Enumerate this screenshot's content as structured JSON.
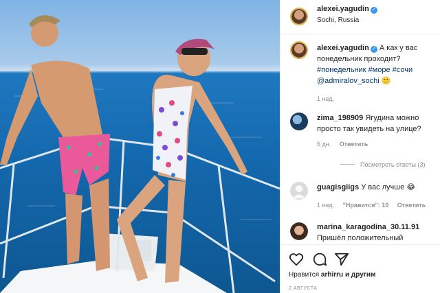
{
  "post": {
    "photo_alt": "",
    "author": "alexei.yagudin",
    "location": "Sochi, Russia"
  },
  "caption": {
    "author": "alexei.yagudin",
    "text": "А как у вас понедельник проходит?",
    "hashtags": [
      "#понедельник",
      "#море",
      "#сочи"
    ],
    "mention": "@admiralov_sochi",
    "mention_suffix": "🙂",
    "time": "1 нед."
  },
  "comments": [
    {
      "user": "zima_198909",
      "text": "Ягудина можно просто так увидеть на улице?",
      "time": "6 дн.",
      "reply_label": "Ответить",
      "view_replies": "Посмотреть ответы (3)"
    },
    {
      "user": "guagisgiigs",
      "text": "У вас лучше 😂",
      "time": "1 нед.",
      "likes_label": "\"Нравится\": 10",
      "reply_label": "Ответить"
    },
    {
      "user": "marina_karagodina_30.11.91",
      "text": "Пришёл положительный"
    }
  ],
  "footer": {
    "liked_prefix": "Нравится",
    "liked_user": "arhirru",
    "liked_suffix": "и другим",
    "date": "2 АВГУСТА"
  },
  "icons": {
    "like": "heart-icon",
    "comment": "comment-bubble-icon",
    "share": "paper-plane-icon",
    "verified": "verified-badge-icon",
    "more": "more-options-icon"
  },
  "colors": {
    "link": "#00376b",
    "verified": "#3897f0",
    "meta": "#8e8e8e",
    "text": "#262626"
  }
}
